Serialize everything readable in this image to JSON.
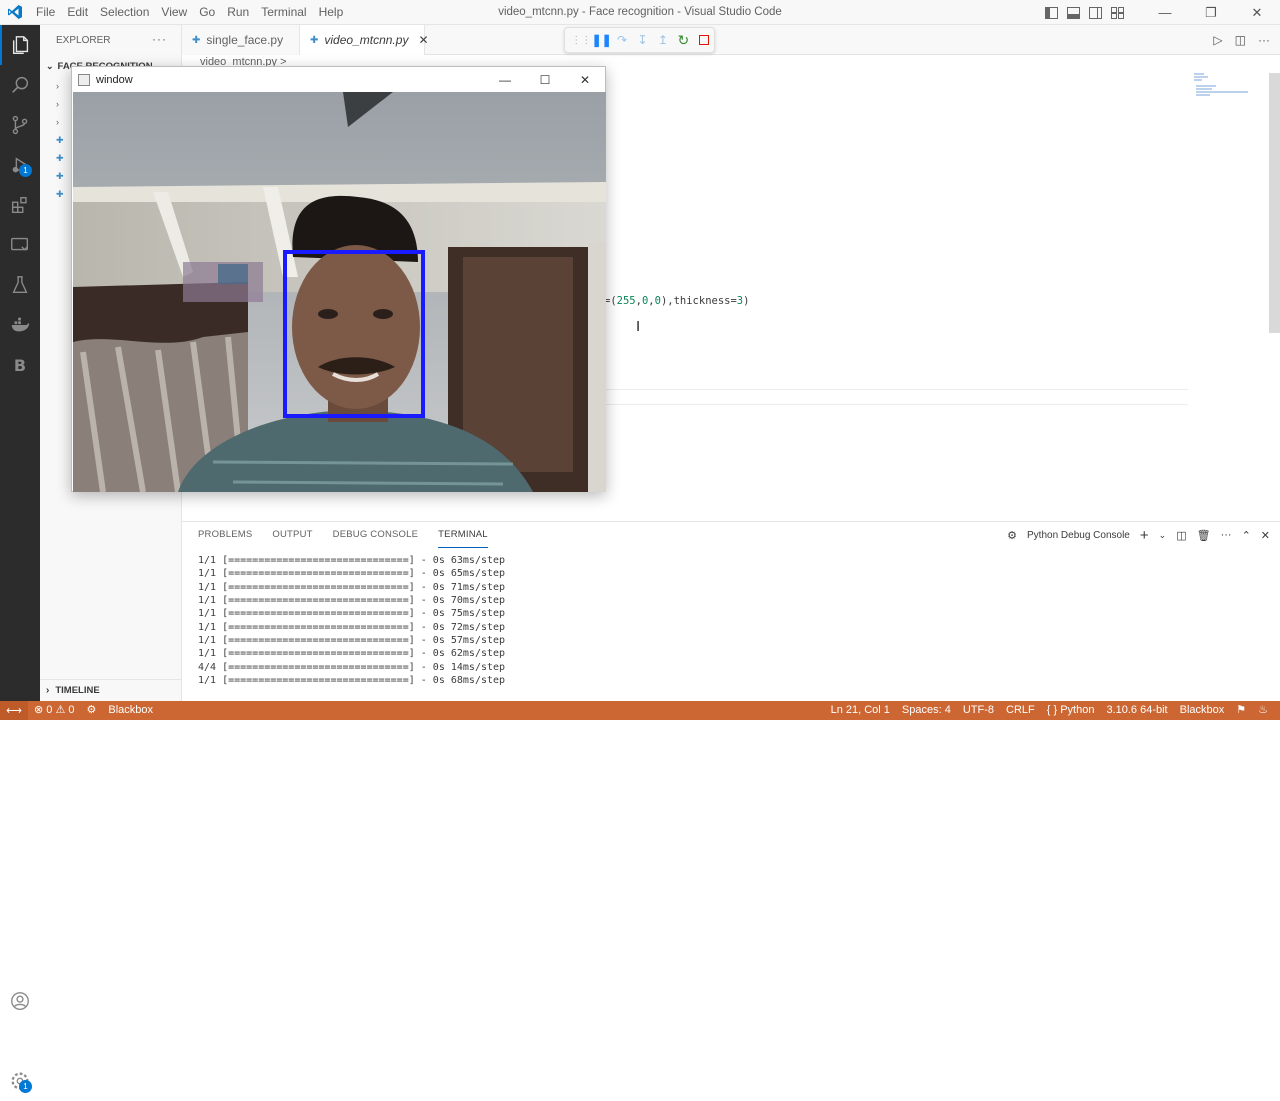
{
  "window": {
    "title": "video_mtcnn.py - Face recognition - Visual Studio Code",
    "menu": [
      "File",
      "Edit",
      "Selection",
      "View",
      "Go",
      "Run",
      "Terminal",
      "Help"
    ]
  },
  "activity_bar": {
    "icons": [
      "explorer-icon",
      "search-icon",
      "source-control-icon",
      "run-debug-icon",
      "extensions-icon",
      "remote-explorer-icon",
      "testing-icon",
      "docker-icon",
      "blackbox-icon",
      "accounts-icon",
      "manage-icon"
    ],
    "debug_badge": "1",
    "manage_badge": "1",
    "blackbox_letter": "B"
  },
  "sidebar": {
    "header": "EXPLORER",
    "more": "···",
    "folder": "FACE RECOGNITION",
    "timeline": "TIMELINE"
  },
  "tabs": [
    {
      "label": "single_face.py",
      "active": false
    },
    {
      "label": "video_mtcnn.py",
      "active": true
    }
  ],
  "breadcrumb": "video_mtcnn.py >",
  "editor": {
    "code_prefix": "=(",
    "code_n1": "255",
    "code_c1": ",",
    "code_n2": "0",
    "code_c2": ",",
    "code_n3": "0",
    "code_mid": "),thickness=",
    "code_n4": "3",
    "code_suffix": ")"
  },
  "cv_window": {
    "title": "window",
    "face_box_color": "#1a1aff"
  },
  "panel": {
    "tabs": [
      "PROBLEMS",
      "OUTPUT",
      "DEBUG CONSOLE",
      "TERMINAL"
    ],
    "active_tab": "TERMINAL",
    "terminal_profile": "Python Debug Console",
    "terminal_lines": [
      "1/1 [==============================] - 0s 63ms/step",
      "1/1 [==============================] - 0s 65ms/step",
      "1/1 [==============================] - 0s 71ms/step",
      "1/1 [==============================] - 0s 70ms/step",
      "1/1 [==============================] - 0s 75ms/step",
      "1/1 [==============================] - 0s 72ms/step",
      "1/1 [==============================] - 0s 57ms/step",
      "1/1 [==============================] - 0s 62ms/step",
      "4/4 [==============================] - 0s 14ms/step",
      "1/1 [==============================] - 0s 68ms/step"
    ]
  },
  "status_bar": {
    "errors": "0",
    "warnings": "0",
    "blackbox": "Blackbox",
    "position": "Ln 21, Col 1",
    "spaces": "Spaces: 4",
    "encoding": "UTF-8",
    "eol": "CRLF",
    "language": "Python",
    "interpreter": "3.10.6 64-bit",
    "blackbox_right": "Blackbox",
    "color": "#cc6633"
  }
}
